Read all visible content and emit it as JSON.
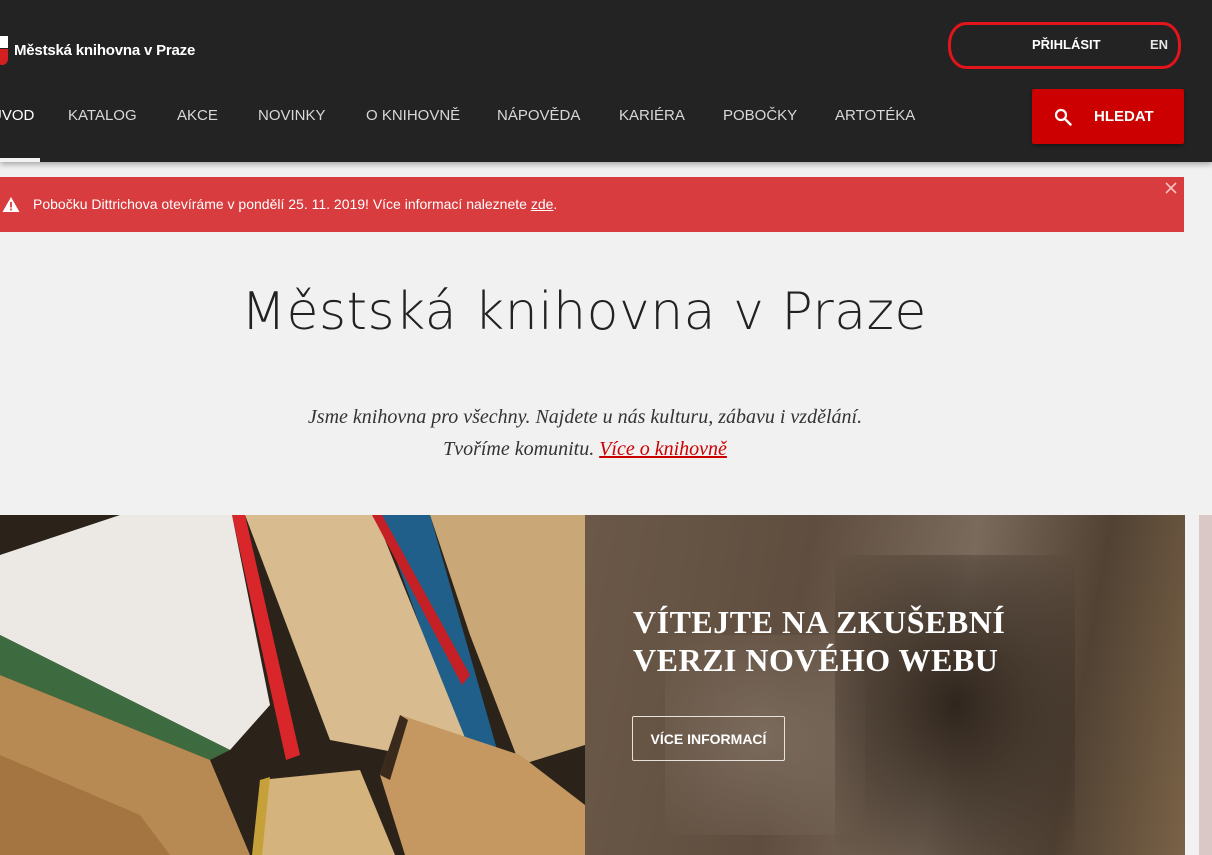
{
  "header": {
    "logo_text": "Městská knihovna v Praze",
    "login_label": "PŘIHLÁSIT",
    "lang_label": "EN",
    "search_label": "HLEDAT",
    "nav": [
      {
        "label": "ÚVOD"
      },
      {
        "label": "KATALOG"
      },
      {
        "label": "AKCE"
      },
      {
        "label": "NOVINKY"
      },
      {
        "label": "O KNIHOVNĚ"
      },
      {
        "label": "NÁPOVĚDA"
      },
      {
        "label": "KARIÉRA"
      },
      {
        "label": "POBOČKY"
      },
      {
        "label": "ARTOTÉKA"
      }
    ]
  },
  "alert": {
    "text": "Pobočku Dittrichova otevíráme v pondělí 25. 11. 2019! Více informací naleznete ",
    "link": "zde",
    "suffix": "."
  },
  "main": {
    "title": "Městská knihovna v Praze",
    "intro_text": "Jsme knihovna pro všechny. Najdete u nás kulturu, zábavu i vzdělání. Tvoříme komunitu. ",
    "intro_link": "Více o knihovně"
  },
  "hero": {
    "heading": "VÍTEJTE NA ZKUŠEBNÍ VERZI NOVÉHO WEBU",
    "button": "VÍCE INFORMACÍ"
  },
  "icons": {
    "search": "search-icon",
    "alert": "warning-icon",
    "close": "close-icon"
  },
  "colors": {
    "header_bg": "#232323",
    "accent": "#cc0000",
    "alert_bg": "#d83c3e",
    "page_bg": "#f1f1f1"
  }
}
